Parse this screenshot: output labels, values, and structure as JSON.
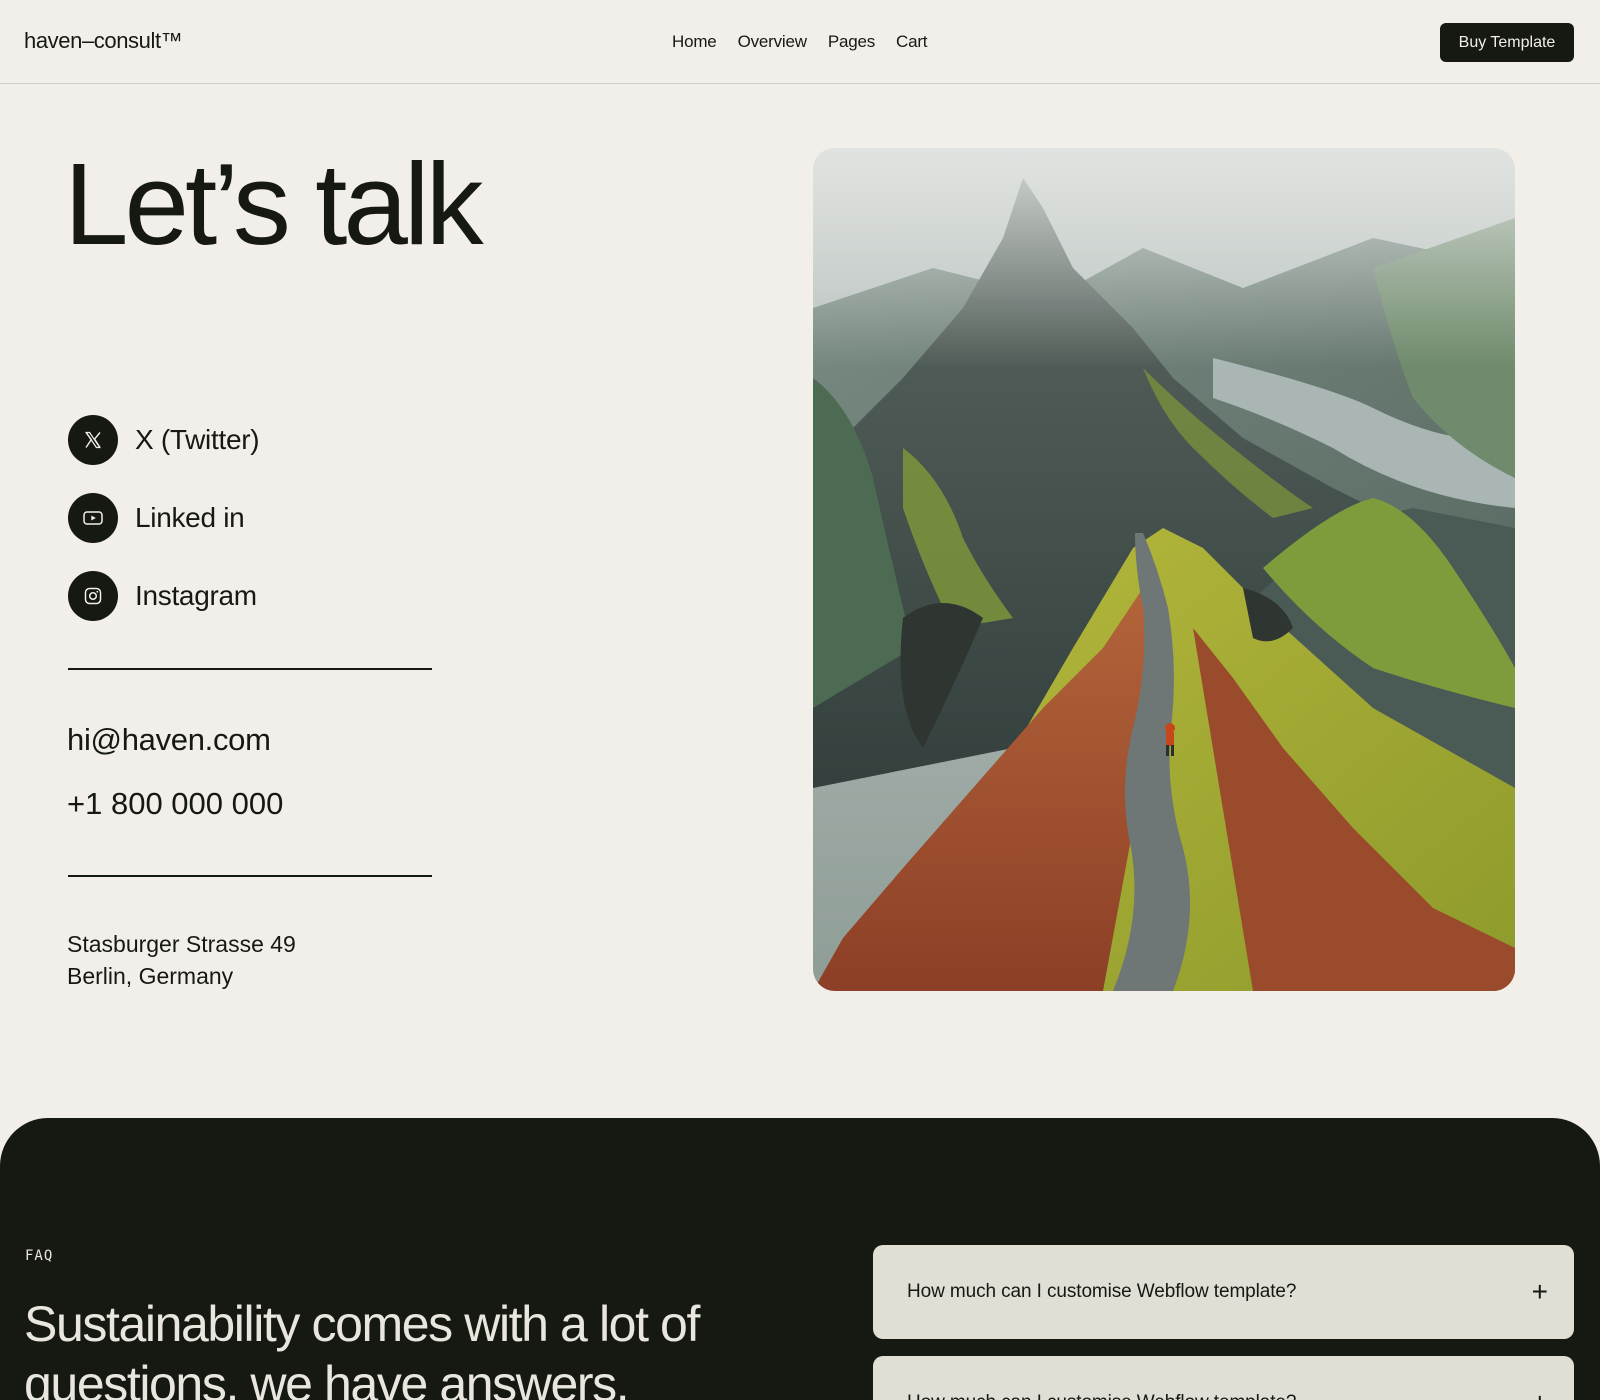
{
  "header": {
    "logo": "haven–consult™",
    "nav": [
      "Home",
      "Overview",
      "Pages",
      "Cart"
    ],
    "cta": "Buy Template"
  },
  "hero": {
    "title": "Let’s talk",
    "socials": [
      {
        "label": "X (Twitter)",
        "icon": "x-twitter-icon"
      },
      {
        "label": "Linked in",
        "icon": "youtube-play-icon"
      },
      {
        "label": "Instagram",
        "icon": "instagram-icon"
      }
    ],
    "email": "hi@haven.com",
    "phone": "+1 800 000 000",
    "address_line1": "Stasburger Strasse 49",
    "address_line2": "Berlin, Germany"
  },
  "faq": {
    "eyebrow": "FAQ",
    "heading": "Sustainability comes with a lot of questions, we have answers.",
    "items": [
      {
        "question": "How much can I customise Webflow template?"
      },
      {
        "question": "How much can I customise Webflow template?"
      }
    ]
  },
  "colors": {
    "background": "#f2efea",
    "ink": "#161912",
    "faq_card": "#dfdfd5"
  }
}
